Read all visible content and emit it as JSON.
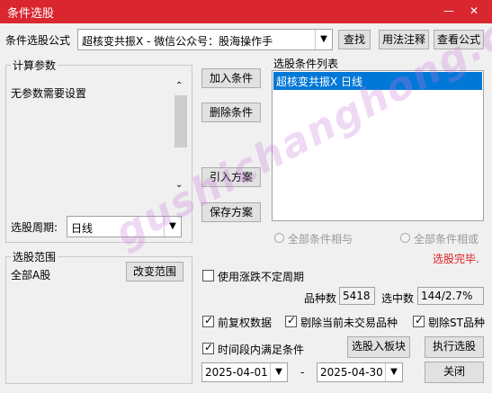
{
  "window": {
    "title": "条件选股"
  },
  "formula": {
    "label": "条件选股公式",
    "value": "超核变共振X  -  微信公众号：股海操作手"
  },
  "buttons": {
    "find": "查找",
    "usage": "用法注释",
    "view": "查看公式",
    "add": "加入条件",
    "delete": "删除条件",
    "import": "引入方案",
    "save": "保存方案",
    "change_range": "改变范围",
    "to_block": "选股入板块",
    "execute": "执行选股",
    "close": "关闭"
  },
  "params": {
    "title": "计算参数",
    "text": "无参数需要设置"
  },
  "period": {
    "label": "选股周期:",
    "value": "日线"
  },
  "condition_list": {
    "title": "选股条件列表",
    "items": [
      "超核变共振X  日线"
    ]
  },
  "radios": {
    "and": "全部条件相与",
    "or": "全部条件相或"
  },
  "status": {
    "done": "选股完毕."
  },
  "range": {
    "title": "选股范围",
    "value": "全部A股"
  },
  "options": {
    "unfixed_period": "使用涨跌不定周期",
    "count_label": "品种数",
    "count_value": "5418",
    "selected_label": "选中数",
    "selected_value": "144/2.7%",
    "pre_adjust": "前复权数据",
    "exclude_untraded": "剔除当前未交易品种",
    "exclude_st": "剔除ST品种",
    "period_satisfy": "时间段内满足条件"
  },
  "dates": {
    "start": "2025-04-01",
    "sep": "-",
    "end": "2025-04-30"
  },
  "watermark": "gushichanghong.com",
  "colors": {
    "title_bar": "#d9262f",
    "selection": "#0078d7",
    "status_red": "#e02020"
  }
}
